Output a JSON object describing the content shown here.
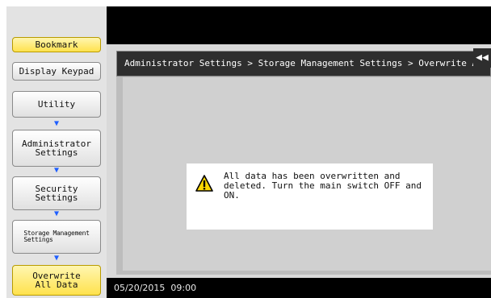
{
  "sidebar": {
    "bookmark_label": "Bookmark",
    "display_keypad_label": "Display Keypad",
    "nav": [
      {
        "label": "Utility"
      },
      {
        "label": "Administrator\nSettings"
      },
      {
        "label": "Security\nSettings"
      },
      {
        "label": "Storage Management\nSettings"
      },
      {
        "label": "Overwrite\nAll Data"
      }
    ],
    "arrow_icon": "down-arrow-icon"
  },
  "header": {
    "breadcrumb": "Administrator Settings > Storage Management Settings > Overwrite All Data",
    "back_icon": "back-double-arrow-icon"
  },
  "message": {
    "text": "All data has been overwritten and deleted. Turn the main switch OFF and ON.",
    "line1": "All data has been overwritten and",
    "line2": "deleted. Turn the main switch OFF and ON.",
    "icon": "warning-icon"
  },
  "status": {
    "datetime": "05/20/2015  09:00"
  },
  "colors": {
    "accent_yellow": "#ffe24d",
    "arrow_blue": "#1f5fff",
    "bar_black": "#000000"
  }
}
